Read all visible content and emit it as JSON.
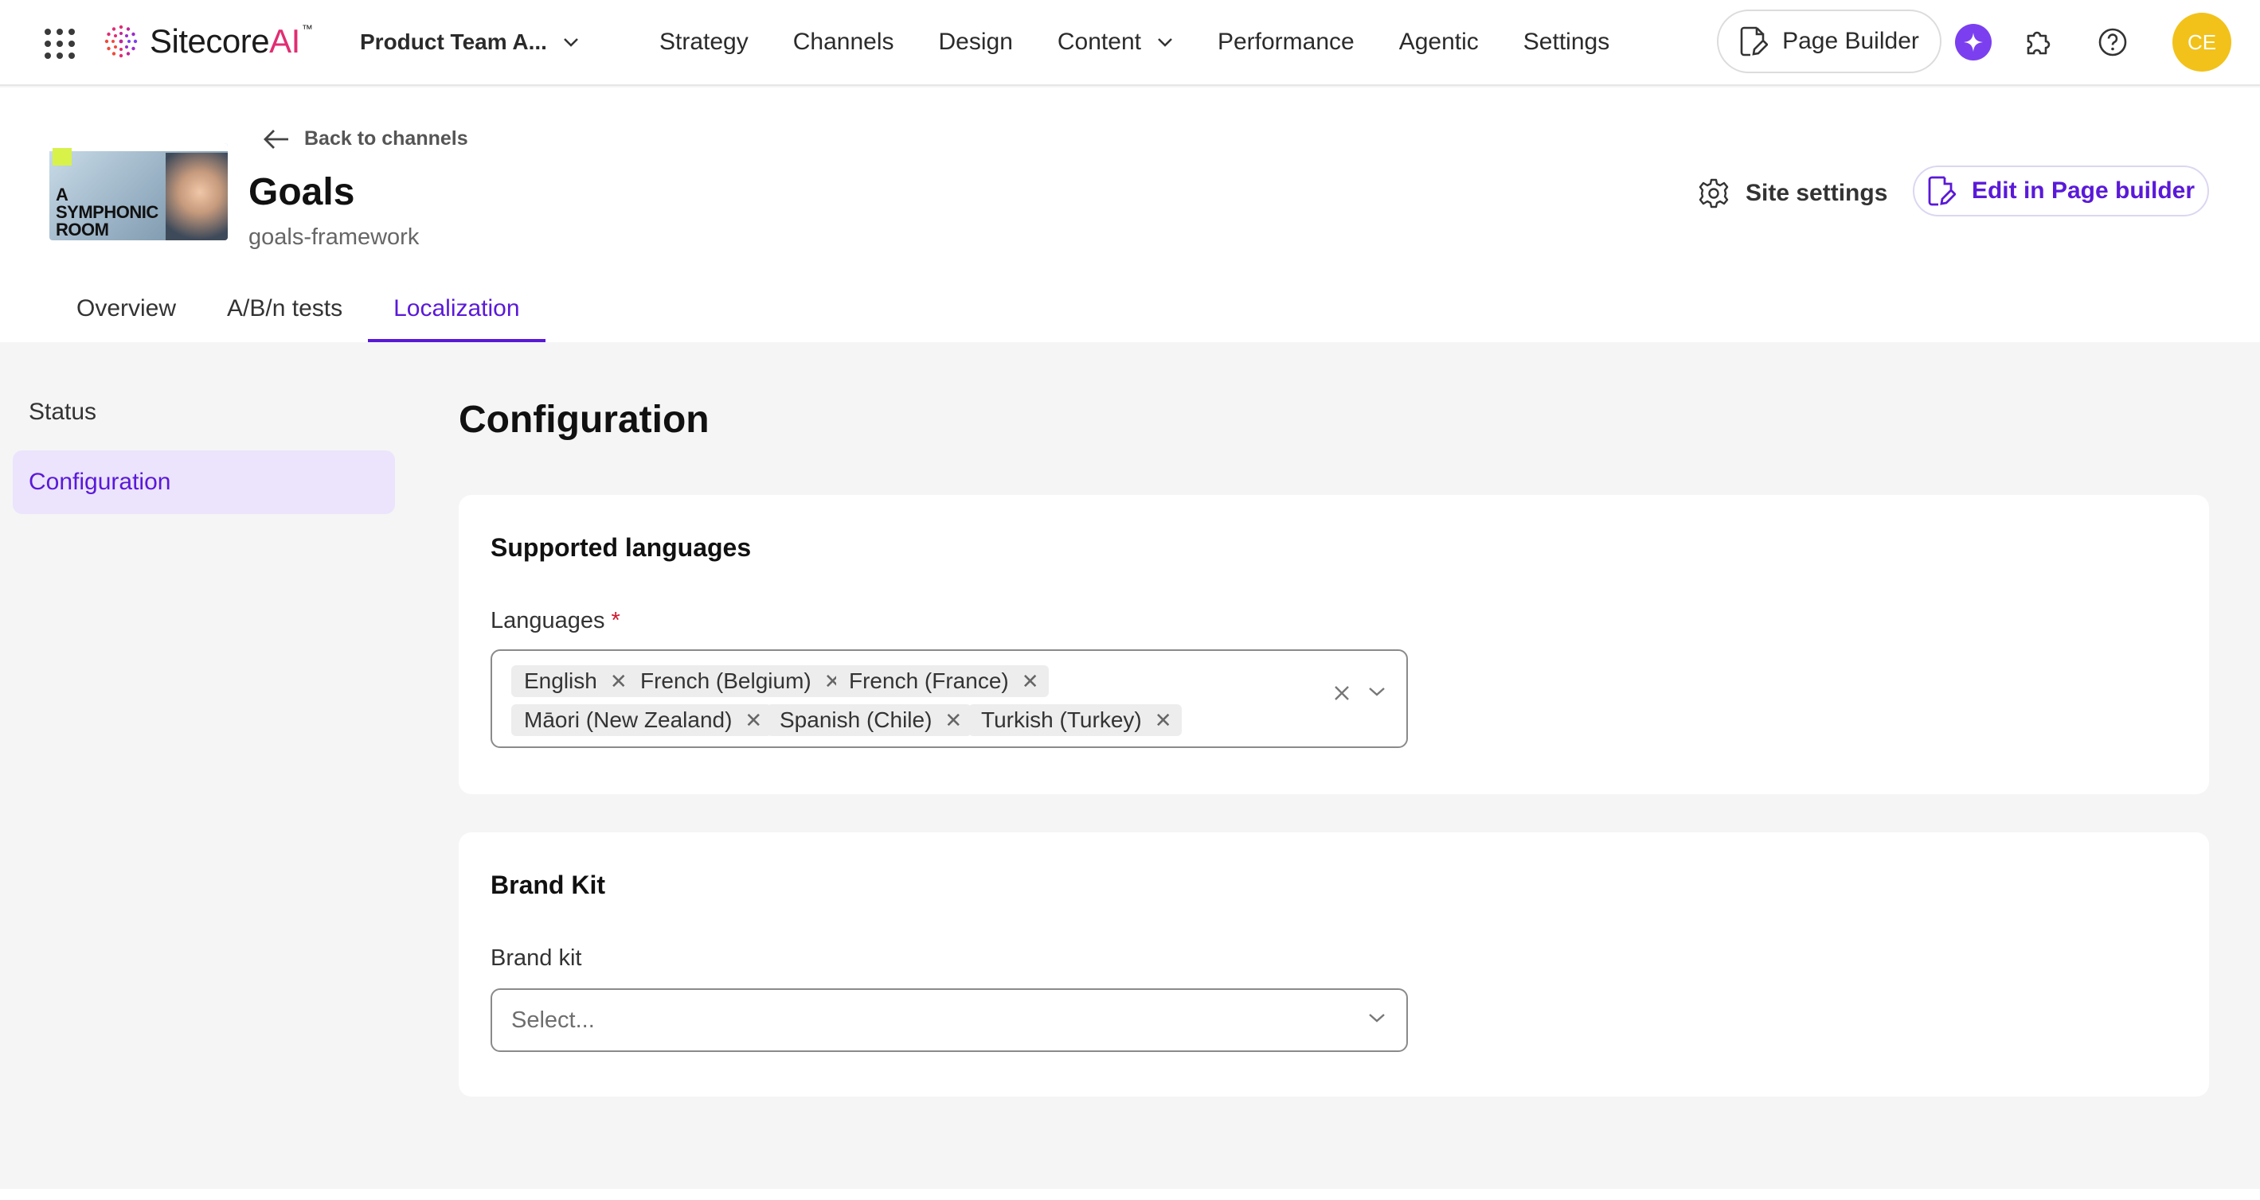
{
  "topnav": {
    "brand": {
      "name": "Sitecore",
      "suffix": "AI",
      "tm": "™"
    },
    "org": "Product Team A...",
    "items": [
      {
        "label": "Strategy"
      },
      {
        "label": "Channels"
      },
      {
        "label": "Design"
      },
      {
        "label": "Content",
        "has_dropdown": true
      },
      {
        "label": "Performance"
      },
      {
        "label": "Agentic"
      },
      {
        "label": "Settings"
      }
    ],
    "page_builder_label": "Page Builder",
    "avatar_initials": "CE"
  },
  "header": {
    "back_label": "Back to channels",
    "title": "Goals",
    "slug": "goals-framework",
    "thumbnail_text": "A SYMPHONIC ROOM",
    "site_settings_label": "Site settings",
    "edit_label": "Edit in Page builder",
    "tabs": [
      {
        "label": "Overview",
        "active": false
      },
      {
        "label": "A/B/n tests",
        "active": false
      },
      {
        "label": "Localization",
        "active": true
      }
    ]
  },
  "sidebar": {
    "items": [
      {
        "label": "Status",
        "active": false
      },
      {
        "label": "Configuration",
        "active": true
      }
    ]
  },
  "main": {
    "title": "Configuration",
    "supported_languages": {
      "title": "Supported languages",
      "field_label": "Languages",
      "required_marker": "*",
      "selected": [
        "English",
        "French (Belgium)",
        "French (France)",
        "Māori (New Zealand)",
        "Spanish (Chile)",
        "Turkish (Turkey)"
      ]
    },
    "brand_kit": {
      "title": "Brand Kit",
      "field_label": "Brand kit",
      "placeholder": "Select..."
    }
  },
  "colors": {
    "accent": "#5a19d8",
    "accent_bg": "#ebe4fc",
    "brand_pink": "#e12d72",
    "ai_purple": "#7b3ff0",
    "avatar": "#f2c21b",
    "required": "#d0192d"
  }
}
